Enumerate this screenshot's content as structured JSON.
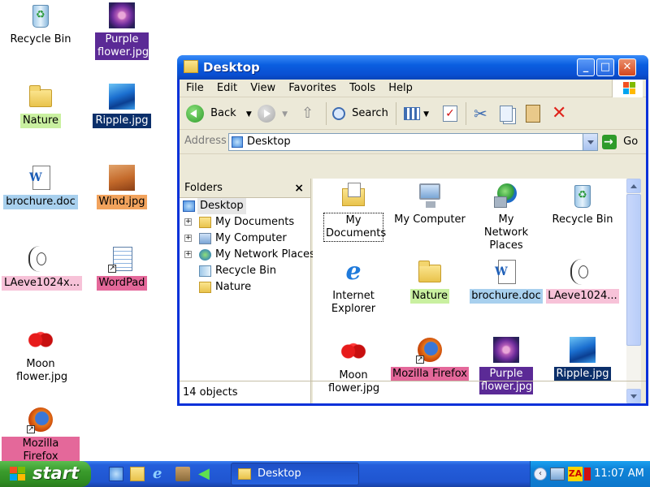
{
  "desktop": {
    "icons": [
      {
        "label": "Recycle Bin"
      },
      {
        "label": "Purple flower.jpg"
      },
      {
        "label": "Nature"
      },
      {
        "label": "Ripple.jpg"
      },
      {
        "label": "brochure.doc"
      },
      {
        "label": "Wind.jpg"
      },
      {
        "label": "LAeve1024x..."
      },
      {
        "label": "WordPad"
      },
      {
        "label": "Moon flower.jpg"
      },
      {
        "label": "Mozilla Firefox"
      }
    ]
  },
  "window": {
    "title": "Desktop",
    "buttons": {
      "minimize": "_",
      "maximize": "□",
      "close": "✕"
    },
    "menu": [
      "File",
      "Edit",
      "View",
      "Favorites",
      "Tools",
      "Help"
    ],
    "toolbar": {
      "back": "Back",
      "search": "Search"
    },
    "address": {
      "label": "Address",
      "value": "Desktop",
      "go": "Go"
    },
    "folders_pane": {
      "title": "Folders",
      "close": "×",
      "items": [
        {
          "label": "Desktop",
          "expander": ""
        },
        {
          "label": "My Documents",
          "expander": "+"
        },
        {
          "label": "My Computer",
          "expander": "+"
        },
        {
          "label": "My Network Places",
          "expander": "+"
        },
        {
          "label": "Recycle Bin",
          "expander": ""
        },
        {
          "label": "Nature",
          "expander": ""
        }
      ]
    },
    "items": [
      {
        "label": "My Documents"
      },
      {
        "label": "My Computer"
      },
      {
        "label": "My Network Places"
      },
      {
        "label": "Recycle Bin"
      },
      {
        "label": "Internet Explorer"
      },
      {
        "label": "Nature"
      },
      {
        "label": "brochure.doc"
      },
      {
        "label": "LAeve1024..."
      },
      {
        "label": "Moon flower.jpg"
      },
      {
        "label": "Mozilla Firefox"
      },
      {
        "label": "Purple flower.jpg"
      },
      {
        "label": "Ripple.jpg"
      }
    ],
    "status": "14 objects"
  },
  "taskbar": {
    "start": "start",
    "task": "Desktop",
    "tray_badge": "ZA",
    "tray_chevron": "‹",
    "clock": "11:07 AM"
  },
  "colors": {
    "window_frame": "#0831d9",
    "taskbar": "#245edb",
    "start_button": "#3a9b2c"
  }
}
